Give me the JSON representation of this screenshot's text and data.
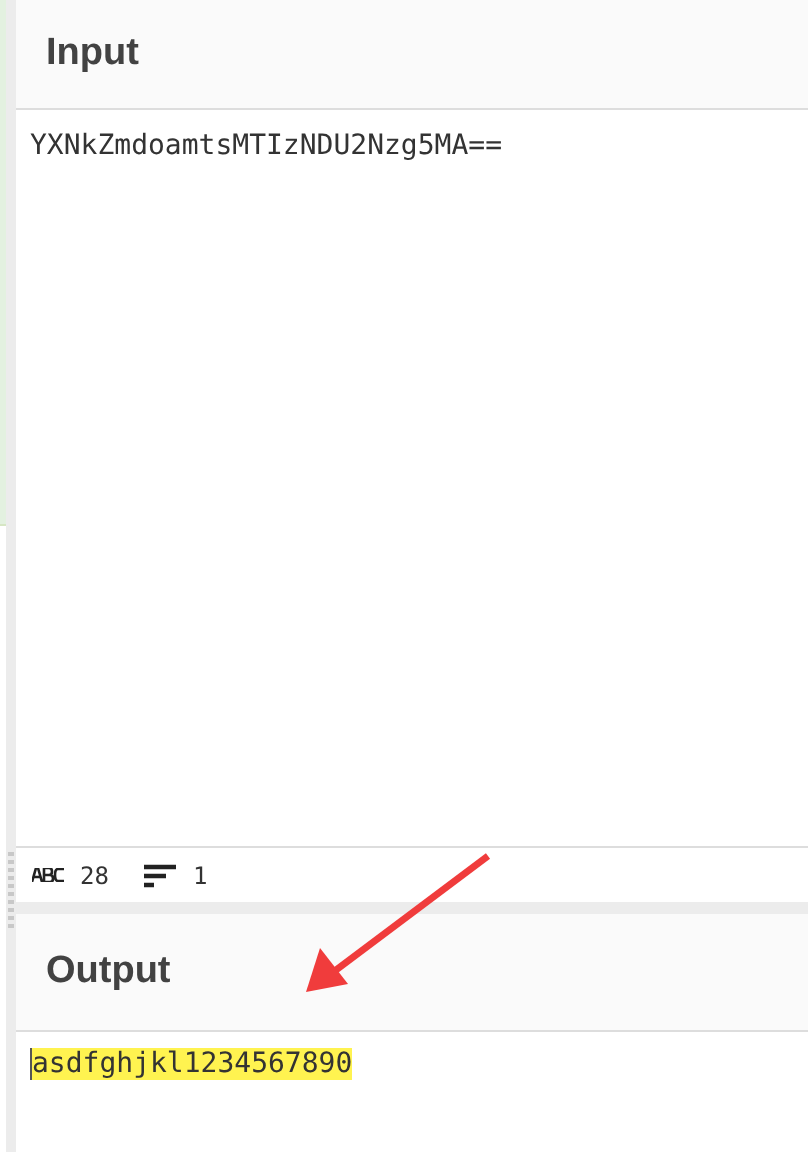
{
  "input": {
    "title": "Input",
    "value": "YXNkZmdoamtsMTIzNDU2Nzg5MA=="
  },
  "status_bar": {
    "characters": "28",
    "lines": "1"
  },
  "output": {
    "title": "Output",
    "value": "asdfghjkl1234567890",
    "highlighted": true
  }
}
